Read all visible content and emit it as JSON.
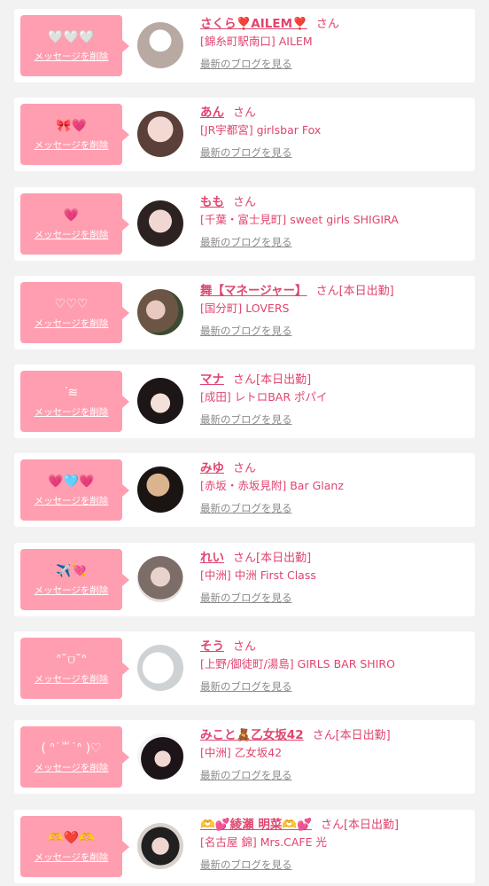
{
  "delete_label": "メッセージを削除",
  "blog_label": "最新のブログを見る",
  "accent_color": "#e0456f",
  "bubble_color": "#ff9eb0",
  "items": [
    {
      "message": "🤍🤍🤍",
      "name": "さくら❣️AILEM❣️",
      "suffix": "さん",
      "shop": "[錦糸町駅南口] AILEM",
      "avatar": "white-heart-photo"
    },
    {
      "message": "🎀💗",
      "name": "あん",
      "suffix": "さん",
      "shop": "[JR宇都宮] girlsbar Fox",
      "avatar": "girl-photo"
    },
    {
      "message": "💗",
      "name": "もも",
      "suffix": "さん",
      "shop": "[千葉・富士見町] sweet girls SHIGIRA",
      "avatar": "girl-photo"
    },
    {
      "message": "♡♡♡",
      "name": "舞【マネージャー】",
      "suffix": "さん[本日出勤]",
      "shop": "[国分町] LOVERS",
      "avatar": "girl-photo"
    },
    {
      "message": "ᐝ≋",
      "name": "マナ",
      "suffix": "さん[本日出勤]",
      "shop": "[成田] レトロBAR ポパイ",
      "avatar": "girl-photo"
    },
    {
      "message": "💗🩵💗",
      "name": "みゆ",
      "suffix": "さん",
      "shop": "[赤坂・赤坂見附] Bar Glanz",
      "avatar": "girl-photo"
    },
    {
      "message": "✈️💘",
      "name": "れい",
      "suffix": "さん[本日出勤]",
      "shop": "[中洲] 中洲 First Class",
      "avatar": "girl-photo"
    },
    {
      "message": "ᐢ˘⩌˘ᐢ",
      "name": "そう",
      "suffix": "さん",
      "shop": "[上野/御徒町/湯島] GIRLS BAR SHIRO",
      "avatar": "dog-photo"
    },
    {
      "message": "( ᐢ˙꒳˙ᐢ )♡",
      "name": "みこと🧸乙女坂42",
      "suffix": "さん[本日出勤]",
      "shop": "[中洲] 乙女坂42",
      "avatar": "girl-photo"
    },
    {
      "message": "🫶❤️🫶",
      "name": "🫶💕綾瀬 明菜🫶💕",
      "suffix": "さん[本日出勤]",
      "shop": "[名古屋 錦] Mrs.CAFE 光",
      "avatar": "girl-photo"
    }
  ]
}
